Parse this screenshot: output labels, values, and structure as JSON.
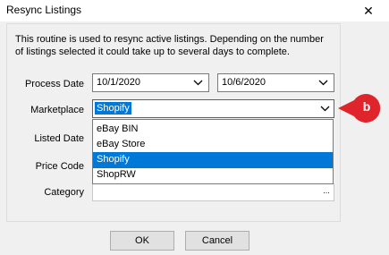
{
  "window": {
    "title": "Resync Listings",
    "close_glyph": "✕"
  },
  "description": "This routine is used to resync active listings. Depending on the number of listings selected it could take up to several days to complete.",
  "process_date": {
    "label": "Process Date",
    "from_value": "10/1/2020",
    "to_value": "10/6/2020"
  },
  "marketplace": {
    "label": "Marketplace",
    "value": "Shopify",
    "options": [
      "eBay BIN",
      "eBay Store",
      "Shopify",
      "ShopRW"
    ],
    "selected_index": 2
  },
  "listed_date": {
    "label": "Listed Date"
  },
  "price_code": {
    "label": "Price Code"
  },
  "category": {
    "label": "Category",
    "browse_glyph": "..."
  },
  "badge": {
    "text": "b",
    "color": "#e0242c"
  },
  "buttons": {
    "ok": "OK",
    "cancel": "Cancel"
  },
  "icons": {
    "chevron": "chevron-down-icon",
    "close": "close-icon"
  }
}
